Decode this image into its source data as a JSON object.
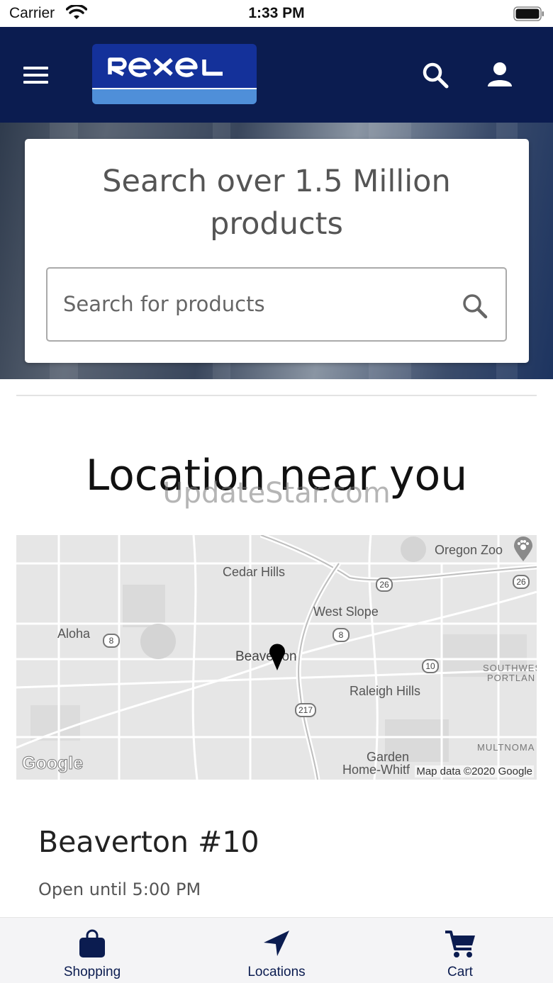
{
  "status_bar": {
    "carrier": "Carrier",
    "time": "1:33 PM"
  },
  "header": {
    "logo_text": "Rexel",
    "brand_colors": {
      "navy": "#0b1c50",
      "logo_blue": "#14319a",
      "logo_light_blue": "#4f8fd9"
    },
    "icons": [
      "menu-icon",
      "search-icon",
      "user-icon"
    ]
  },
  "hero": {
    "title": "Search over 1.5 Million products",
    "search_placeholder": "Search for products"
  },
  "locations": {
    "heading": "Location near you",
    "watermark": "UpdateStar.com"
  },
  "map": {
    "labels": {
      "oregon_zoo": "Oregon Zoo",
      "cedar_hills": "Cedar Hills",
      "west_slope": "West Slope",
      "aloha": "Aloha",
      "beaverton": "Beaverton",
      "raleigh_hills": "Raleigh Hills",
      "southwest_portland_1": "SOUTHWES",
      "southwest_portland_2": "PORTLAN",
      "multnomah": "MULTNOMA",
      "garden_home_1": "Garden",
      "garden_home_2": "Home-Whitf"
    },
    "shields": {
      "r26a": "26",
      "r26b": "26",
      "r8a": "8",
      "r8b": "8",
      "r10": "10",
      "r217": "217"
    },
    "google": "Google",
    "attribution": "Map data ©2020 Google"
  },
  "store": {
    "name": "Beaverton #10",
    "hours": "Open until 5:00 PM"
  },
  "tabbar": {
    "tabs": [
      {
        "label": "Shopping",
        "icon": "shopping-bag-icon"
      },
      {
        "label": "Locations",
        "icon": "location-arrow-icon"
      },
      {
        "label": "Cart",
        "icon": "cart-icon"
      }
    ]
  }
}
